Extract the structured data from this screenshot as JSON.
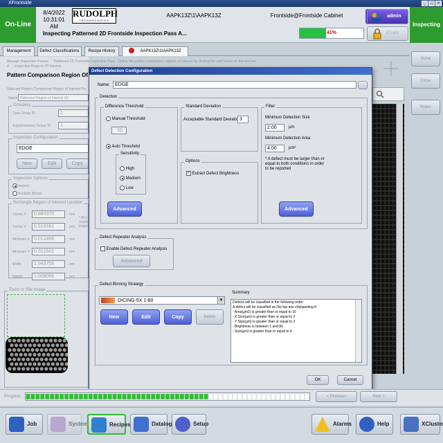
{
  "window": {
    "title": "XFrontside"
  },
  "header": {
    "status": "On-Line",
    "date": "8/4/2022",
    "time": "10:31:01 AM",
    "logo_main": "RUDOLPH",
    "logo_sub": "TECHNOLOGIES",
    "recipe_path": "AAPK13Z\\1\\AAPK13Z",
    "location": "Frontside@Frontside Cabinet",
    "user": "admin",
    "xclaim": "XClaim",
    "mode": "Inspecting",
    "subtitle": "Inspecting Patterned 2D Frontside Inspection Pass A...",
    "progress_text": "41%",
    "progress_value": 0.41
  },
  "tabs": [
    "Management",
    "Defect Classifications",
    "Recipe History",
    "AAPK13Z\\1\\AAPK13Z"
  ],
  "left": {
    "breadcrumb": "Manage Inspection Passes → Patterned 2D Frontside Inspection Pass . Define the pattern comparison regions of interest by clicking the add button on the tool bar.",
    "breadcrumb2": "A → Inspection Regions Of Interest",
    "heading": "Pattern Comparison Region Of Intere",
    "selected_label": "Selected Pattern Comparison Region of Interest Pa",
    "name_label": "Name",
    "name_value": "Patterned Region of Interest 69",
    "grouping_label": "Grouping",
    "type_group_label": "Type Group ID",
    "type_group_value": "1",
    "supp_group_label": "Supplementary Group ID",
    "supp_group_value": "1",
    "insp_config_label": "Inspection Configuration",
    "insp_config_value": "EDGE",
    "new_btn": "New",
    "edit_btn": "Edit",
    "copy_btn": "Copy",
    "insp_options_label": "Inspection Options",
    "inspect_label": "Inspect",
    "exclude_label": "Exclude (Mask)",
    "rect_label": "Rectangle Region of Interest Location",
    "center_x_label": "Center X",
    "center_x": "0.984375",
    "center_y_label": "Center Y",
    "center_y": "0.515591",
    "min_x_label": "Minimum X",
    "min_x": "0.012496",
    "min_y_label": "Minimum Y",
    "min_y": "0.011543",
    "width_label": "Width",
    "width": "1.943756",
    "height_label": "Height",
    "height": "1.008096",
    "unit": "mm",
    "note": "* All c relativ inspec",
    "zoom_label": "Zoom to Site Image"
  },
  "right_buttons": [
    "Done",
    "Close",
    "Notes"
  ],
  "dialog": {
    "title": "Defect Detection Configuration",
    "name_label": "Name:",
    "name_value": "EDGE",
    "detection_label": "Detection",
    "diff_threshold_label": "Difference Threshold",
    "manual_threshold": "Manual Threshold",
    "manual_value": "10",
    "auto_threshold": "Auto Threshold",
    "sensitivity_label": "Sensitivity",
    "high": "High",
    "medium": "Medium",
    "low": "Low",
    "advanced": "Advanced",
    "std_dev_label": "Standard Deviation",
    "acceptable_std": "Acceptable Standard Deviation",
    "std_value": "3",
    "options_label": "Options",
    "extract_brightness": "Extract Defect Brightness",
    "filter_label": "Filter",
    "min_size_label": "Minimum Detection Size",
    "min_size_value": "2.00",
    "min_size_unit": "µm",
    "min_area_label": "Minimum Detection Area",
    "min_area_value": "4.00",
    "min_area_unit": "µm²",
    "filter_note": "* A defect must be larger than or equal to both conditions in order to be reported",
    "repeater_label": "Defect Repeater Analysis",
    "enable_repeater": "Enable Defect Repeater Analysis",
    "binning_label": "Defect Binning Strategy",
    "binning_value": "DICING-5X 1-80",
    "new": "New",
    "edit": "Edit",
    "copy": "Copy",
    "delete": "Delete",
    "summary_label": "Summary",
    "summary_lines": [
      "Defects will be classified in the following order:",
      "A defect will be classified as Die top ase chip\\peeling if:",
      " - Area(µm2) is greater than or equal to 16",
      " - X Size(µm) is greater than or equal to 2",
      " - Y Size(µm) is greater than or equal to 2",
      " - Brightness is between 1 and 80",
      " - Size(µm) is greater than or equal to 4"
    ],
    "ok": "OK",
    "cancel": "Cancel"
  },
  "progress": {
    "label": "Progress",
    "previous": "< Previous",
    "next": "Next >"
  },
  "taskbar": [
    "Job",
    "System",
    "Recipes",
    "Datalog",
    "Setup",
    "Alarms",
    "Help",
    "XCluster"
  ]
}
